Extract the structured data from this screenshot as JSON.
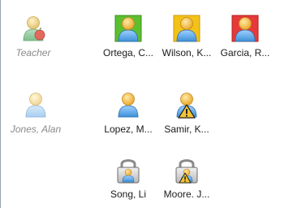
{
  "teacher": {
    "label": "Teacher",
    "icon": "teacher-apple-icon"
  },
  "students": [
    {
      "name": "Ortega, C...",
      "icon": "student-icon",
      "status_color": "#5cbf2f",
      "status": "green"
    },
    {
      "name": "Wilson, K...",
      "icon": "student-icon",
      "status_color": "#f2c218",
      "status": "yellow"
    },
    {
      "name": "Garcia, R...",
      "icon": "student-icon",
      "status_color": "#e63a3a",
      "status": "red"
    },
    {
      "name": "Jones, Alan",
      "icon": "student-offline-icon",
      "status": "offline"
    },
    {
      "name": "Lopez, M...",
      "icon": "student-icon",
      "status": "none"
    },
    {
      "name": "Samir, K...",
      "icon": "student-warning-icon",
      "status": "warning"
    },
    {
      "name": "Song, Li",
      "icon": "student-locked-icon",
      "status": "locked"
    },
    {
      "name": "Moore. J...",
      "icon": "student-locked-warning-icon",
      "status": "locked-warning"
    }
  ]
}
